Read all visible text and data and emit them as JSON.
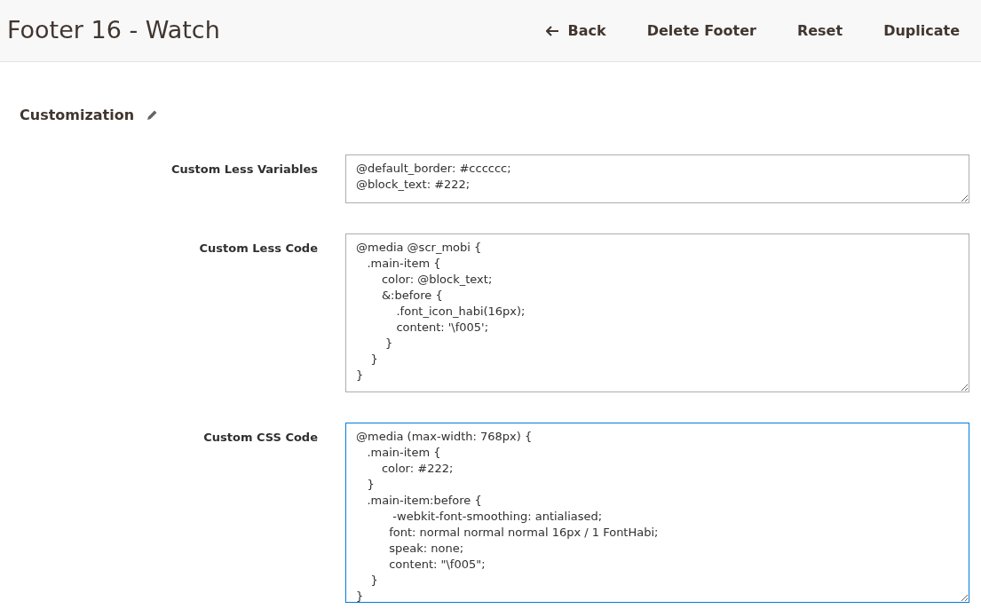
{
  "header": {
    "title": "Footer 16 - Watch",
    "actions": [
      {
        "label": "Back",
        "kind": "back"
      },
      {
        "label": "Delete Footer",
        "kind": "plain"
      },
      {
        "label": "Reset",
        "kind": "plain"
      },
      {
        "label": "Duplicate",
        "kind": "plain"
      }
    ]
  },
  "section": {
    "title": "Customization"
  },
  "fields": [
    {
      "label": "Custom Less Variables",
      "value": "@default_border: #cccccc;\n@block_text: #222;",
      "focused": false
    },
    {
      "label": "Custom Less Code",
      "value": "@media @scr_mobi {\n   .main-item {\n       color: @block_text;\n       &:before {\n           .font_icon_habi(16px);\n           content: '\\f005';\n        }\n    }\n}",
      "focused": false
    },
    {
      "label": "Custom CSS Code",
      "value": "@media (max-width: 768px) {\n   .main-item {\n       color: #222;\n   }\n   .main-item:before {\n          -webkit-font-smoothing: antialiased;\n         font: normal normal normal 16px / 1 FontHabi;\n         speak: none;\n         content: \"\\f005\";\n    }\n}",
      "focused": true
    }
  ]
}
